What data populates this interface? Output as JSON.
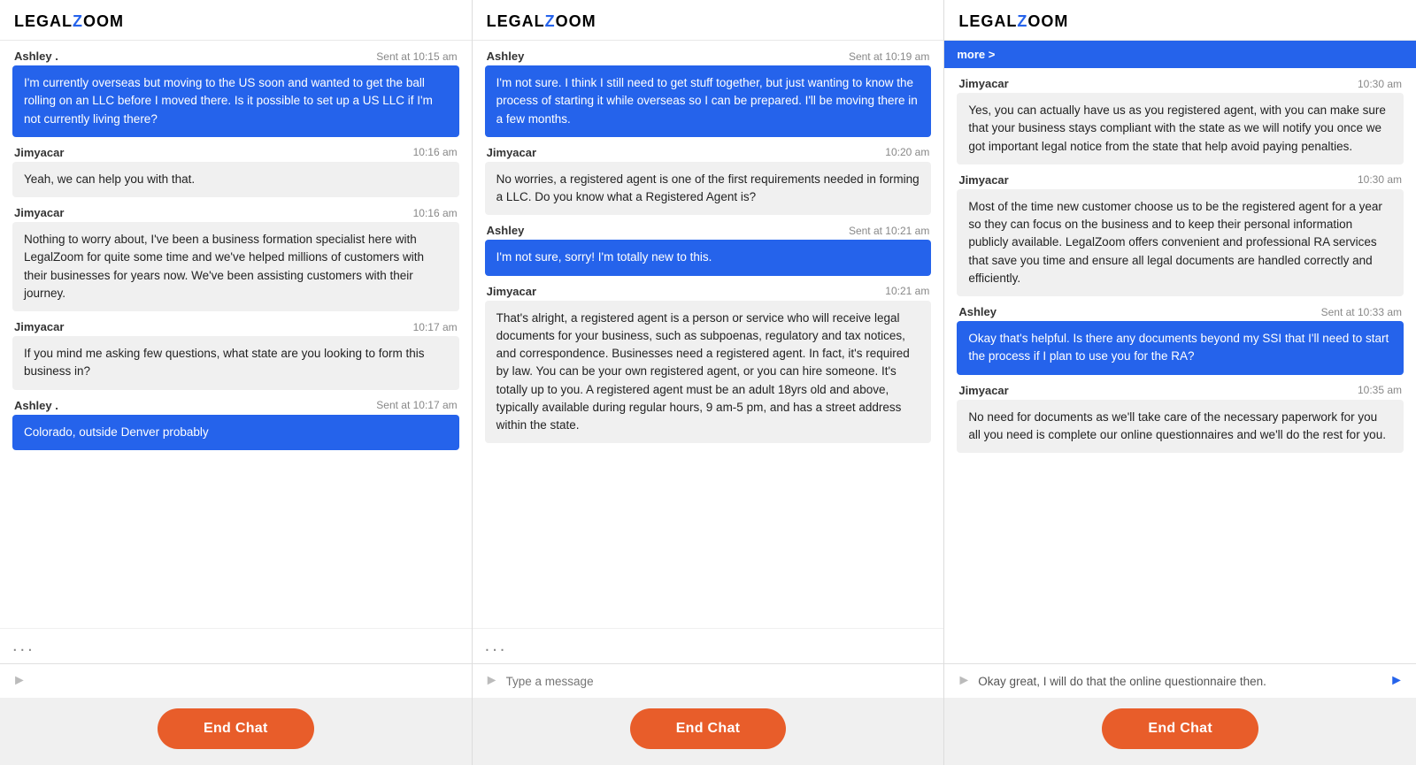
{
  "panels": [
    {
      "id": "panel1",
      "logo": "LEGALZOOM",
      "messages": [
        {
          "sender": "Ashley .",
          "time": "Sent at 10:15 am",
          "type": "user",
          "text": "I'm currently overseas but moving to the US soon and wanted to get the ball rolling on an LLC before I moved there. Is it possible to set up a US LLC if I'm not currently living there?"
        },
        {
          "sender": "Jimyacar",
          "time": "10:16 am",
          "type": "agent",
          "text": "Yeah, we can help you with that."
        },
        {
          "sender": "Jimyacar",
          "time": "10:16 am",
          "type": "agent",
          "text": "Nothing to worry about, I've been a business formation specialist here with LegalZoom for quite some time and we've helped millions of customers with their businesses for years now. We've been assisting customers with their journey."
        },
        {
          "sender": "Jimyacar",
          "time": "10:17 am",
          "type": "agent",
          "text": "If you mind me asking few questions, what state are you looking to form this business in?"
        },
        {
          "sender": "Ashley .",
          "time": "Sent at 10:17 am",
          "type": "user",
          "text": "Colorado, outside Denver probably"
        }
      ],
      "typing": "...",
      "input_placeholder": "",
      "input_value": "",
      "end_chat_label": "End Chat"
    },
    {
      "id": "panel2",
      "logo": "LEGALZOOM",
      "messages": [
        {
          "sender": "Ashley",
          "time": "Sent at 10:19 am",
          "type": "user",
          "text": "I'm not sure. I think I still need to get stuff together, but just wanting to know the process of starting it while overseas so I can be prepared. I'll be moving there in a few months."
        },
        {
          "sender": "Jimyacar",
          "time": "10:20 am",
          "type": "agent",
          "text": "No worries, a registered agent is one of the first requirements needed in forming a LLC. Do you know what a Registered Agent is?"
        },
        {
          "sender": "Ashley",
          "time": "Sent at 10:21 am",
          "type": "user",
          "text": "I'm not sure, sorry! I'm totally new to this."
        },
        {
          "sender": "Jimyacar",
          "time": "10:21 am",
          "type": "agent",
          "text": "That's alright, a registered agent is a person or service who will receive legal documents for your business, such as subpoenas, regulatory and tax notices, and correspondence. Businesses need a registered agent. In fact, it's required by law. You can be your own registered agent, or you can hire someone. It's totally up to you. A registered agent must be an adult 18yrs old and above, typically available during regular hours, 9 am-5 pm, and has a street address within the state."
        }
      ],
      "typing": "...",
      "input_placeholder": "Type a message",
      "input_value": "",
      "end_chat_label": "End Chat"
    },
    {
      "id": "panel3",
      "logo": "LEGALZOOM",
      "blue_bar": "more >",
      "messages": [
        {
          "sender": "Jimyacar",
          "time": "10:30 am",
          "type": "agent",
          "text": "Yes, you can actually have us as you registered agent, with you can make sure that your business stays compliant with the state as we will notify you once we got important legal notice from the state that help avoid paying penalties."
        },
        {
          "sender": "Jimyacar",
          "time": "10:30 am",
          "type": "agent",
          "text": "Most of the time new customer choose us to be the registered agent for a year so they can focus on the business and to keep their personal information publicly available. LegalZoom offers convenient and professional RA services that save you time and ensure all legal documents are handled correctly and efficiently."
        },
        {
          "sender": "Ashley",
          "time": "Sent at 10:33 am",
          "type": "user",
          "text": "Okay that's helpful. Is there any documents beyond my SSI that I'll need to start the process if I plan to use you for the RA?"
        },
        {
          "sender": "Jimyacar",
          "time": "10:35 am",
          "type": "agent",
          "text": "No need for documents as we'll take care of the necessary paperwork for you all you need is complete our online questionnaires and we'll do the rest for you."
        }
      ],
      "typing": null,
      "input_placeholder": "",
      "input_value": "Okay great, I will do that the online questionnaire then.",
      "end_chat_label": "End Chat"
    }
  ]
}
